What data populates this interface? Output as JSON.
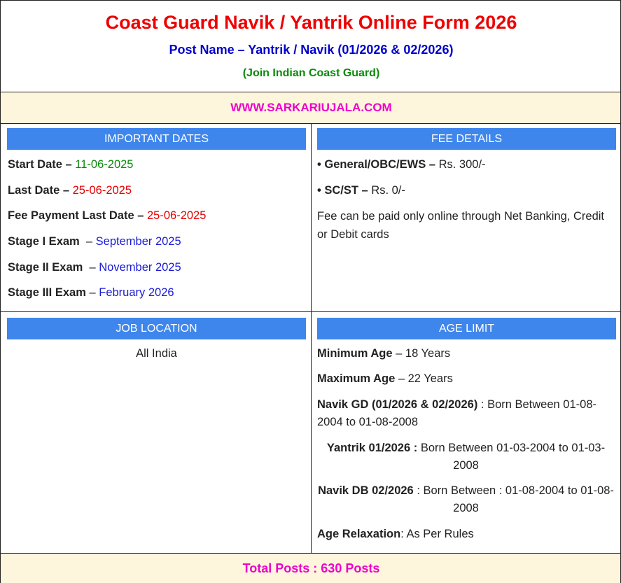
{
  "header": {
    "title": "Coast Guard Navik / Yantrik Online Form 2026",
    "post_name": "Post Name – Yantrik / Navik (01/2026 & 02/2026)",
    "join": "(Join Indian Coast Guard)"
  },
  "website": "WWW.SARKARIUJALA.COM",
  "important_dates": {
    "heading": "IMPORTANT DATES",
    "items": [
      {
        "label": "Start Date – ",
        "value": "11-06-2025",
        "color": "#0a8a0a"
      },
      {
        "label": "Last Date – ",
        "value": "25-06-2025",
        "color": "#e60000"
      },
      {
        "label": "Fee Payment Last Date – ",
        "value": "25-06-2025",
        "color": "#e60000"
      },
      {
        "label": "Stage I Exam",
        "sep": "  – ",
        "value": "September 2025",
        "color": "#1a1ad4"
      },
      {
        "label": "Stage II Exam",
        "sep": "  – ",
        "value": "November 2025",
        "color": "#1a1ad4"
      },
      {
        "label": "Stage III Exam",
        "sep": " – ",
        "value": "February 2026",
        "color": "#1a1ad4"
      }
    ]
  },
  "fee_details": {
    "heading": "FEE DETAILS",
    "items": [
      {
        "label": "• General/OBC/EWS – ",
        "value": "Rs. 300/-"
      },
      {
        "label": "• SC/ST – ",
        "value": "Rs. 0/-"
      }
    ],
    "note": "Fee can be paid only online through Net Banking, Credit or Debit cards"
  },
  "job_location": {
    "heading": "JOB LOCATION",
    "value": "All India"
  },
  "age_limit": {
    "heading": "AGE LIMIT",
    "min_label": "Minimum Age",
    "min_value": " – 18 Years",
    "max_label": "Maximum Age",
    "max_value": " – 22 Years",
    "navik_gd_label": "Navik GD (01/2026 & 02/2026)",
    "navik_gd_value": " : Born Between 01-08-2004 to 01-08-2008",
    "yantrik_label": "Yantrik 01/2026 :",
    "yantrik_value": " Born Between 01-03-2004 to 01-03-2008",
    "navik_db_label": "Navik DB 02/2026",
    "navik_db_value": " : Born Between : 01-08-2004 to 01-08-2008",
    "relax_label": "Age Relaxation",
    "relax_value": ": As Per Rules"
  },
  "total_posts": "Total Posts : 630 Posts",
  "colors": {
    "title": "#ee0000",
    "post": "#0000cc",
    "join": "#0a8a0a",
    "website": "#ee00cc",
    "band_bg": "#fdf6dc",
    "section_header": "#3f86ec"
  }
}
